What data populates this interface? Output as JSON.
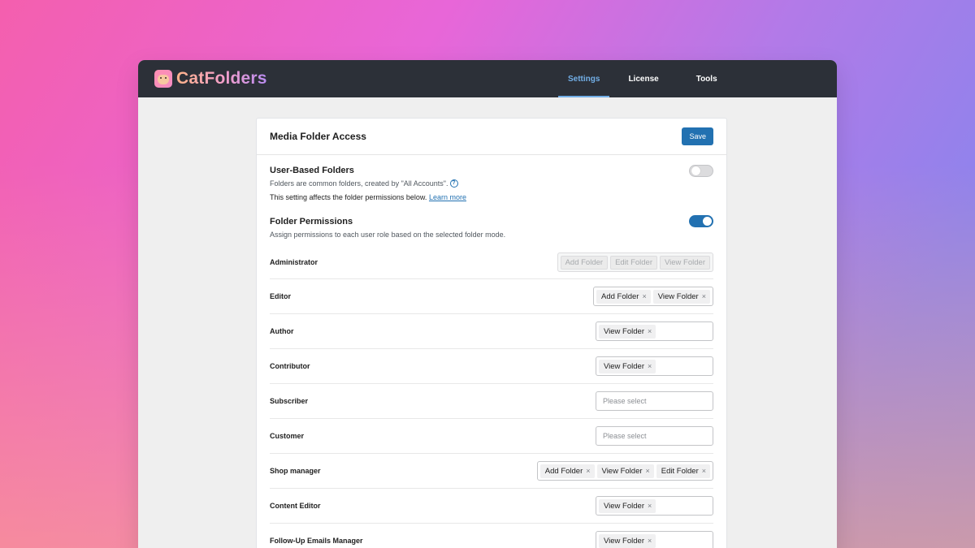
{
  "brand": {
    "name": "CatFolders"
  },
  "nav": {
    "items": [
      {
        "label": "Settings",
        "active": true
      },
      {
        "label": "License",
        "active": false
      },
      {
        "label": "Tools",
        "active": false
      }
    ]
  },
  "panel": {
    "title": "Media Folder Access",
    "save_label": "Save",
    "user_based": {
      "title": "User-Based Folders",
      "desc": "Folders are common folders, created by \"All Accounts\".",
      "note": "This setting affects the folder permissions below.",
      "learn_more": "Learn more",
      "enabled": false
    },
    "permissions": {
      "title": "Folder Permissions",
      "desc": "Assign permissions to each user role based on the selected folder mode.",
      "enabled": true
    },
    "placeholder": "Please select",
    "roles": [
      {
        "name": "Administrator",
        "permissions": [
          "Add Folder",
          "Edit Folder",
          "View Folder"
        ],
        "disabled": true
      },
      {
        "name": "Editor",
        "permissions": [
          "Add Folder",
          "View Folder"
        ],
        "disabled": false
      },
      {
        "name": "Author",
        "permissions": [
          "View Folder"
        ],
        "disabled": false
      },
      {
        "name": "Contributor",
        "permissions": [
          "View Folder"
        ],
        "disabled": false
      },
      {
        "name": "Subscriber",
        "permissions": [],
        "disabled": false
      },
      {
        "name": "Customer",
        "permissions": [],
        "disabled": false
      },
      {
        "name": "Shop manager",
        "permissions": [
          "Add Folder",
          "View Folder",
          "Edit Folder"
        ],
        "disabled": false
      },
      {
        "name": "Content Editor",
        "permissions": [
          "View Folder"
        ],
        "disabled": false
      },
      {
        "name": "Follow-Up Emails Manager",
        "permissions": [
          "View Folder"
        ],
        "disabled": false
      }
    ],
    "remove_glyph": "×"
  },
  "colors": {
    "accent": "#2271b1",
    "nav_active": "#72aee6",
    "topbar": "#2c3038"
  }
}
